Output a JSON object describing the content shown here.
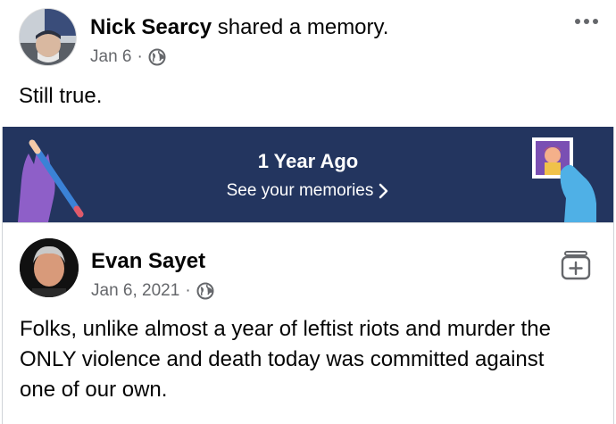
{
  "outer_post": {
    "author": "Nick Searcy",
    "action": "shared a memory.",
    "date": "Jan 6",
    "separator": "·",
    "text": "Still true.",
    "audience_icon": "globe-icon",
    "menu_icon": "more-horizontal-icon"
  },
  "memory_banner": {
    "title": "1 Year Ago",
    "link_label": "See your memories",
    "link_icon": "chevron-right-icon",
    "background": "#23355f"
  },
  "inner_post": {
    "author": "Evan Sayet",
    "date": "Jan 6, 2021",
    "separator": "·",
    "audience_icon": "globe-icon",
    "action_icon": "archive-add-icon",
    "text_lines": [
      "Folks, unlike almost a year of leftist riots and murder the",
      "ONLY violence and death today was committed against",
      "one of our own."
    ]
  },
  "colors": {
    "primary_text": "#050505",
    "secondary_text": "#65676b",
    "banner_text": "#ffffff"
  }
}
